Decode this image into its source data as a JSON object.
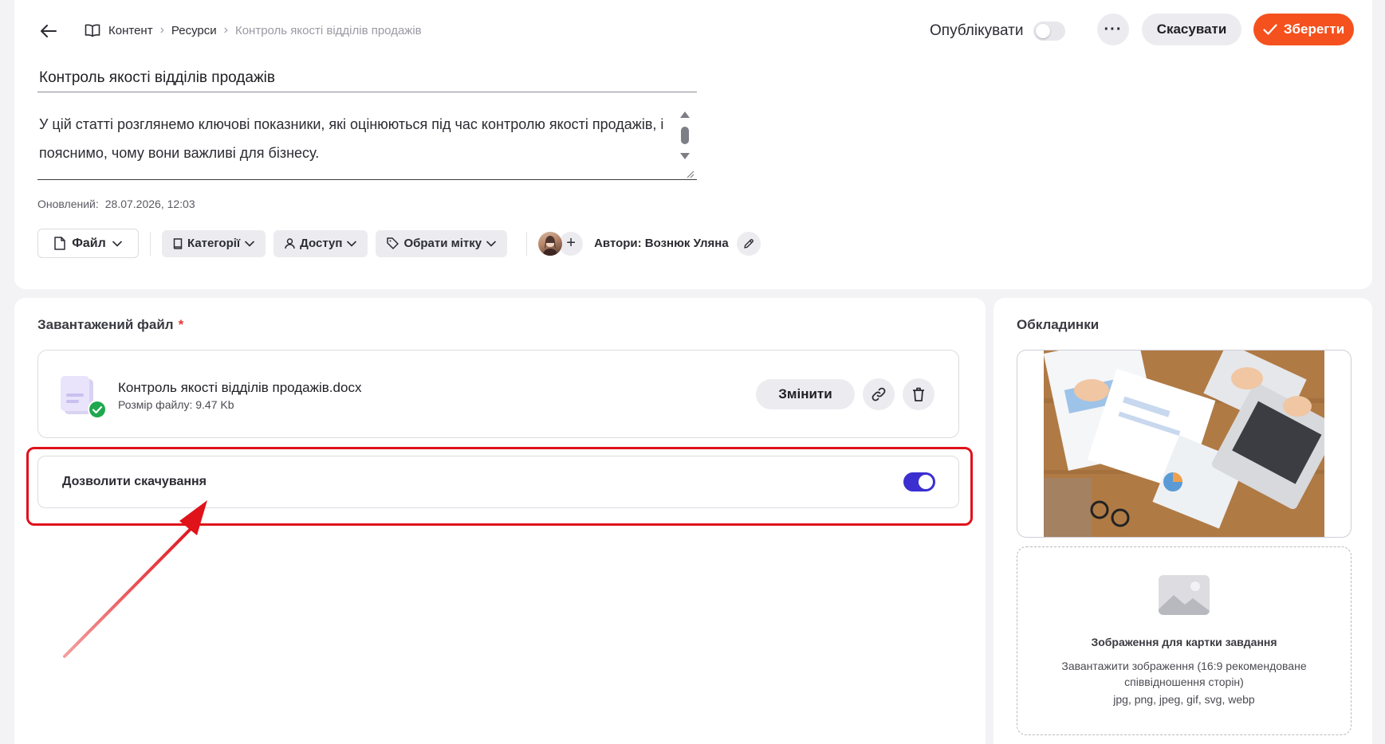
{
  "header": {
    "back_icon": "arrow-left-icon",
    "breadcrumb": {
      "icon": "book-icon",
      "items": [
        "Контент",
        "Ресурси",
        "Контроль якості відділів продажів"
      ]
    },
    "publish_label": "Опублікувати",
    "publish_enabled": false,
    "more_label": "···",
    "cancel_label": "Скасувати",
    "save_label": "Зберегти",
    "save_color": "#f4511e"
  },
  "editor": {
    "title": "Контроль якості відділів продажів",
    "description": "У цій статті розглянемо ключові показники, які оцінюються під час контролю якості продажів, і пояснимо, чому вони важливі для бізнесу.",
    "updated_label": "Оновлений:",
    "updated_value": "28.07.2026, 12:03"
  },
  "toolbar": {
    "file_label": "Файл",
    "categories_label": "Категорії",
    "access_label": "Доступ",
    "tag_label": "Обрати мітку",
    "authors_label": "Автори: Вознюк Уляна"
  },
  "uploaded_file": {
    "section_title": "Завантажений файл",
    "required_mark": "*",
    "file_name": "Контроль якості відділів продажів.docx",
    "file_size": "Розмір файлу: 9.47 Kb",
    "change_label": "Змінити",
    "allow_download_label": "Дозволити скачування",
    "allow_download_enabled": true,
    "toggle_color": "#3b2fd0",
    "highlight_color": "#e0121a"
  },
  "covers": {
    "section_title": "Обкладинки",
    "upload_title": "Зображення для картки завдання",
    "upload_hint": "Завантажити зображення (16:9 рекомендоване співвідношення сторін)",
    "upload_formats": "jpg, png, jpeg, gif, svg, webp"
  }
}
